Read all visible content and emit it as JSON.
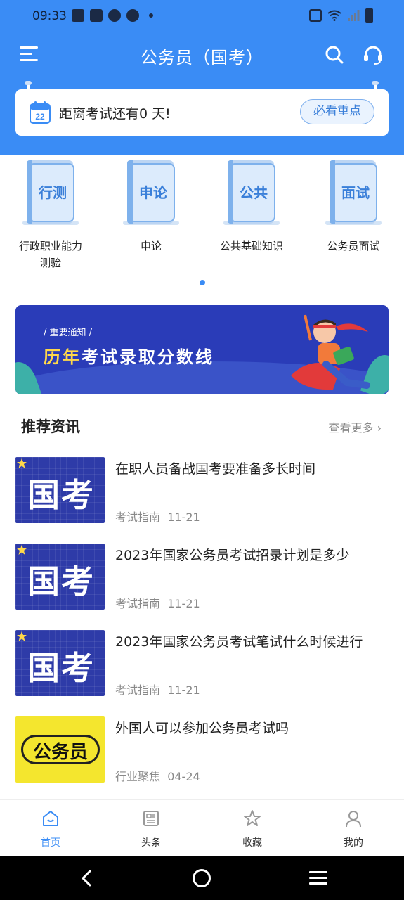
{
  "status_bar": {
    "time": "09:33"
  },
  "header": {
    "title": "公务员（国考）"
  },
  "countdown": {
    "text": "距离考试还有0 天!",
    "calendar_day": "22",
    "button_label": "必看重点"
  },
  "categories": [
    {
      "book_label": "行测",
      "label": "行政职业能力\n测验"
    },
    {
      "book_label": "申论",
      "label": "申论"
    },
    {
      "book_label": "公共",
      "label": "公共基础知识"
    },
    {
      "book_label": "面试",
      "label": "公务员面试"
    }
  ],
  "banner": {
    "tag": "/ 重要通知 /",
    "title_highlight": "历年",
    "title_rest": "考试录取分数线"
  },
  "recommend": {
    "title": "推荐资讯",
    "more": "查看更多",
    "items": [
      {
        "thumb": "国考",
        "title": "在职人员备战国考要准备多长时间",
        "category": "考试指南",
        "date": "11-21"
      },
      {
        "thumb": "国考",
        "title": "2023年国家公务员考试招录计划是多少",
        "category": "考试指南",
        "date": "11-21"
      },
      {
        "thumb": "国考",
        "title": "2023年国家公务员考试笔试什么时候进行",
        "category": "考试指南",
        "date": "11-21"
      },
      {
        "thumb": "公务员",
        "title": "外国人可以参加公务员考试吗",
        "category": "行业聚焦",
        "date": "04-24"
      }
    ]
  },
  "tabbar": {
    "items": [
      {
        "label": "首页",
        "icon": "home-icon",
        "active": true
      },
      {
        "label": "头条",
        "icon": "news-icon",
        "active": false
      },
      {
        "label": "收藏",
        "icon": "star-icon",
        "active": false
      },
      {
        "label": "我的",
        "icon": "user-icon",
        "active": false
      }
    ]
  },
  "colors": {
    "primary": "#3a8cf5",
    "banner": "#2a3cb8",
    "thumb_yellow": "#f4e62e"
  }
}
